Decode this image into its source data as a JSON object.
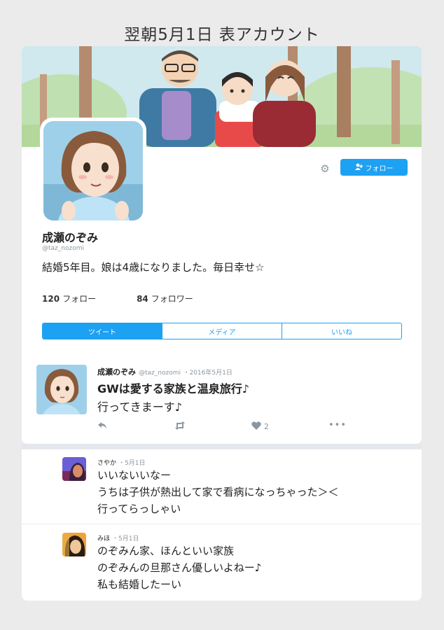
{
  "page": {
    "title": "翌朝5月1日 表アカウント"
  },
  "profile": {
    "display_name": "成瀬のぞみ",
    "handle": "@taz_nozomi",
    "bio": "結婚5年目。娘は4歳になりました。毎日幸せ☆",
    "following_count": "120",
    "following_label": "フォロー",
    "followers_count": "84",
    "followers_label": "フォロワー",
    "follow_button_label": "フォロー",
    "follow_icon": "add-user-icon",
    "settings_icon": "gear-icon"
  },
  "tabs": [
    {
      "label": "ツイート",
      "active": true
    },
    {
      "label": "メディア",
      "active": false
    },
    {
      "label": "いいね",
      "active": false
    }
  ],
  "tweet": {
    "name": "成瀬のぞみ",
    "handle": "@taz_nozomi",
    "date": "・2016年5月1日",
    "line1": "GWは愛する家族と温泉旅行♪",
    "line2": "行ってきまーす♪",
    "like_count": "2"
  },
  "replies": [
    {
      "name": "さやか",
      "date": "・5月1日",
      "lines": [
        "いいないいなー",
        "うちは子供が熱出して家で看病になっちゃった＞＜",
        "行ってらっしゃい"
      ]
    },
    {
      "name": "みほ",
      "date": "・5月1日",
      "lines": [
        "のぞみん家、ほんといい家族",
        "のぞみんの旦那さん優しいよねー♪",
        "私も結婚したーい"
      ]
    }
  ],
  "colors": {
    "accent": "#1da1f2",
    "background": "#ebebeb",
    "muted": "#8b97a0"
  }
}
